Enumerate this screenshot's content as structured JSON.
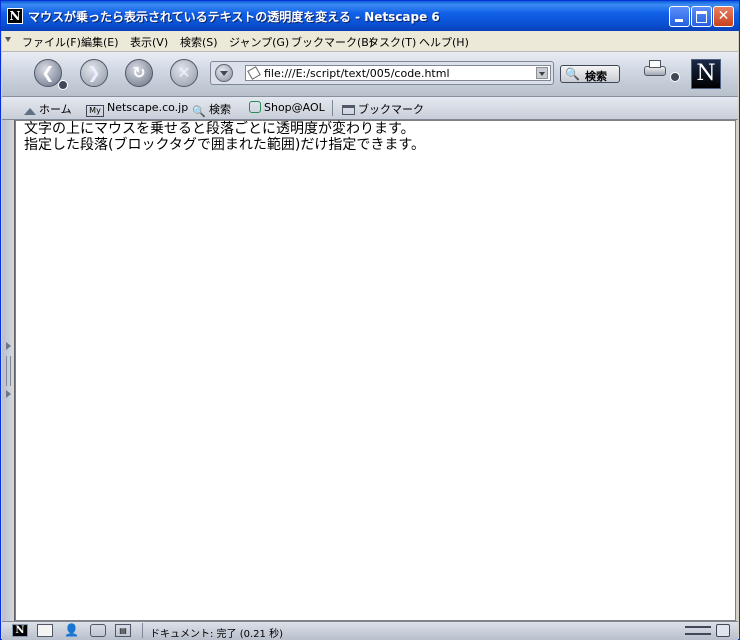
{
  "window": {
    "title": "マウスが乗ったら表示されているテキストの透明度を変える - Netscape 6",
    "app_icon_letter": "N"
  },
  "menu": [
    {
      "label": "ファイル(F)"
    },
    {
      "label": "編集(E)"
    },
    {
      "label": "表示(V)"
    },
    {
      "label": "検索(S)"
    },
    {
      "label": "ジャンプ(G)"
    },
    {
      "label": "ブックマーク(B)"
    },
    {
      "label": "タスク(T)"
    },
    {
      "label": "ヘルプ(H)"
    }
  ],
  "navigation": {
    "url": "file:///E:/script/text/005/code.html",
    "search_label": "検索",
    "logo_letter": "N"
  },
  "bookmarks": [
    {
      "label": "ホーム",
      "icon": "home-icon"
    },
    {
      "label": "Netscape.co.jp",
      "icon": "my-netscape-icon"
    },
    {
      "label": "検索",
      "icon": "search-icon"
    },
    {
      "label": "Shop@AOL",
      "icon": "shop-icon"
    },
    {
      "label": "ブックマーク",
      "icon": "folder-icon"
    }
  ],
  "page": {
    "lines": [
      "文字の上にマウスを乗せると段落ごとに透明度が変わります。",
      "指定した段落(ブロックタグで囲まれた範囲)だけ指定できます。"
    ]
  },
  "status": {
    "text": "ドキュメント: 完了 (0.21 秒)"
  },
  "colors": {
    "titlebar": "#0a4fd0",
    "content_bg": "#ffffff"
  }
}
